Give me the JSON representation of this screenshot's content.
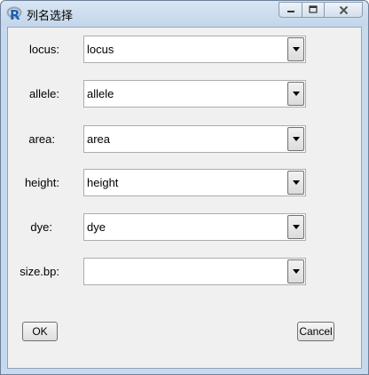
{
  "window": {
    "title": "列名选择",
    "app_icon": "R",
    "controls": [
      "minimize-icon",
      "maximize-icon",
      "close-icon"
    ]
  },
  "form": {
    "rows": [
      {
        "label": "locus:",
        "value": "locus"
      },
      {
        "label": "allele:",
        "value": "allele"
      },
      {
        "label": "area:",
        "value": "area"
      },
      {
        "label": "height:",
        "value": "height"
      },
      {
        "label": "dye:",
        "value": "dye"
      },
      {
        "label": "size.bp:",
        "value": ""
      }
    ]
  },
  "buttons": {
    "ok": "OK",
    "cancel": "Cancel"
  },
  "colors": {
    "title_bar": "#c7d9ec",
    "dialog_background": "#f0f0f0",
    "close_glyph": "#555555"
  }
}
